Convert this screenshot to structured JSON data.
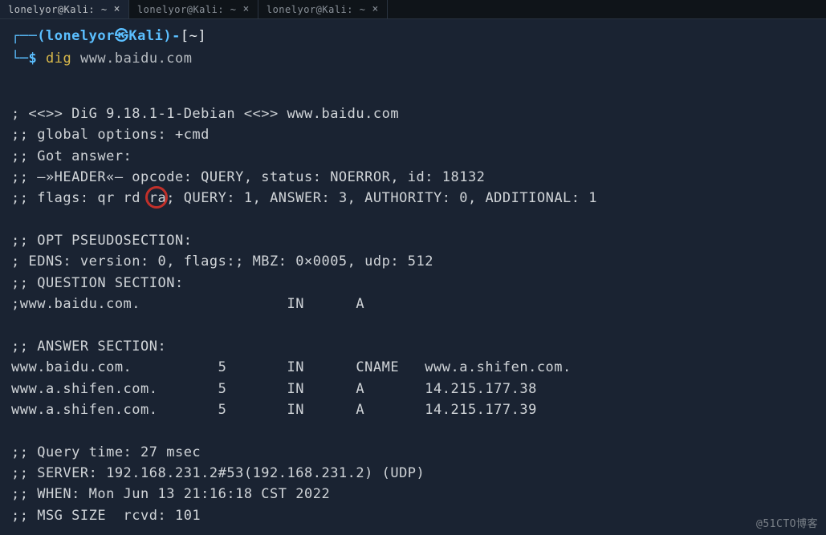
{
  "tabs": [
    {
      "label": "lonelyor@Kali: ~",
      "close": "×",
      "active": true
    },
    {
      "label": "lonelyor@Kali: ~",
      "close": "×",
      "active": false
    },
    {
      "label": "lonelyor@Kali: ~",
      "close": "×",
      "active": false
    }
  ],
  "prompt": {
    "corner_top": "┌──",
    "open": "(",
    "user": "lonelyor",
    "sep": "㉿",
    "host": "Kali",
    "close": ")",
    "dash": "-",
    "path_open": "[",
    "path": "~",
    "path_close": "]",
    "corner_bot": "└─",
    "dollar": "$",
    "cmd": "dig",
    "arg": "www.baidu.com"
  },
  "output": {
    "l1": "",
    "l2": "; <<>> DiG 9.18.1-1-Debian <<>> www.baidu.com",
    "l3": ";; global options: +cmd",
    "l4": ";; Got answer:",
    "l5": ";; —»HEADER«— opcode: QUERY, status: NOERROR, id: 18132",
    "l6a": ";; flags: qr rd ",
    "l6_circ": "ra",
    "l6b": "; QUERY: 1, ANSWER: 3, AUTHORITY: 0, ADDITIONAL: 1",
    "l7": "",
    "l8": ";; OPT PSEUDOSECTION:",
    "l9": "; EDNS: version: 0, flags:; MBZ: 0×0005, udp: 512",
    "l10": ";; QUESTION SECTION:",
    "l11": ";www.baidu.com.                 IN      A",
    "l12": "",
    "l13": ";; ANSWER SECTION:",
    "l14": "www.baidu.com.          5       IN      CNAME   www.a.shifen.com.",
    "l15": "www.a.shifen.com.       5       IN      A       14.215.177.38",
    "l16": "www.a.shifen.com.       5       IN      A       14.215.177.39",
    "l17": "",
    "l18": ";; Query time: 27 msec",
    "l19": ";; SERVER: 192.168.231.2#53(192.168.231.2) (UDP)",
    "l20": ";; WHEN: Mon Jun 13 21:16:18 CST 2022",
    "l21": ";; MSG SIZE  rcvd: 101"
  },
  "watermark": "@51CTO博客"
}
